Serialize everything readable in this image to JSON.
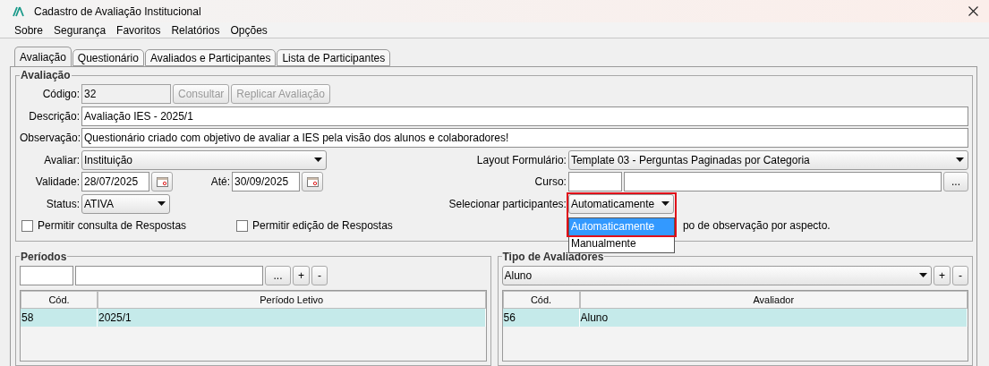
{
  "window": {
    "title": "Cadastro de Avaliação Institucional"
  },
  "menu": [
    {
      "label": "Sobre"
    },
    {
      "label": "Segurança"
    },
    {
      "label": "Favoritos"
    },
    {
      "label": "Relatórios"
    },
    {
      "label": "Opções"
    }
  ],
  "tabs": [
    {
      "label": "Avaliação",
      "selected": true
    },
    {
      "label": "Questionário",
      "selected": false
    },
    {
      "label": "Avaliados e Participantes",
      "selected": false
    },
    {
      "label": "Lista de Participantes",
      "selected": false
    }
  ],
  "avaliacao": {
    "title": "Avaliação",
    "codigo": {
      "label": "Código:",
      "value": "32"
    },
    "actions": [
      {
        "label": "Consultar",
        "disabled": true
      },
      {
        "label": "Replicar Avaliação",
        "disabled": true
      }
    ],
    "descricao": {
      "label": "Descrição:",
      "value": "Avaliação IES - 2025/1"
    },
    "observacao": {
      "label": "Observação:",
      "value": "Questionário criado com objetivo de avaliar a IES pela visão dos alunos e colaboradores!"
    },
    "avaliar": {
      "label": "Avaliar:",
      "value": "Instituição"
    },
    "layout": {
      "label": "Layout Formulário:",
      "value": "Template 03 - Perguntas Paginadas por Categoria"
    },
    "validade": {
      "label": "Validade:",
      "value": "28/07/2025"
    },
    "ate": {
      "label": "Até:",
      "value": "30/09/2025"
    },
    "curso": {
      "label": "Curso:",
      "button": "..."
    },
    "status": {
      "label": "Status:",
      "value": "ATIVA"
    },
    "participantes": {
      "label": "Selecionar participantes:",
      "value": "Automaticamente",
      "open": true,
      "options": [
        {
          "label": "Automaticamente",
          "selected": true
        },
        {
          "label": "Manualmente",
          "selected": false
        }
      ]
    },
    "checkboxes": [
      {
        "label": "Permitir consulta de Respostas",
        "checked": false
      },
      {
        "label": "Permitir edição de Respostas",
        "checked": false
      }
    ],
    "covered_text": "po de observação por aspecto."
  },
  "periodos": {
    "title": "Períodos",
    "buttons": [
      "...",
      "+",
      "-"
    ],
    "columns": [
      "Cód.",
      "Período Letivo"
    ],
    "rows": [
      {
        "cells": [
          "58",
          "2025/1"
        ],
        "selected": true
      }
    ]
  },
  "avaliadores": {
    "title": "Tipo de Avaliadores",
    "value": "Aluno",
    "buttons": [
      "+",
      "-"
    ],
    "columns": [
      "Cód.",
      "Avaliador"
    ],
    "rows": [
      {
        "cells": [
          "56",
          "Aluno"
        ],
        "selected": true
      }
    ]
  }
}
